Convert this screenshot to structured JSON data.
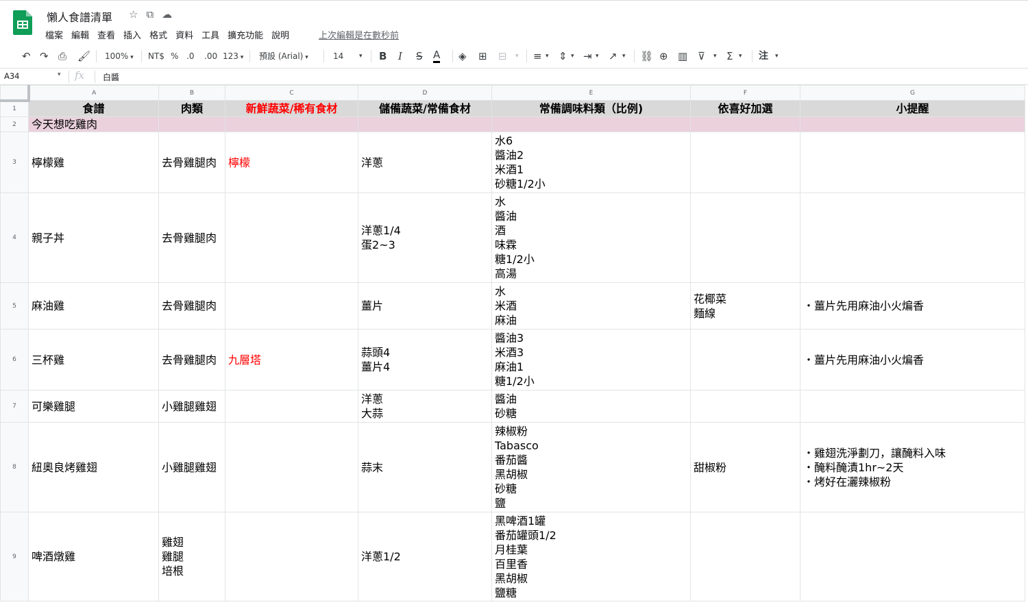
{
  "doc": {
    "title": "懶人食譜清單",
    "last_edit": "上次編輯是在數秒前",
    "menu": [
      "檔案",
      "編輯",
      "查看",
      "插入",
      "格式",
      "資料",
      "工具",
      "擴充功能",
      "說明"
    ]
  },
  "toolbar": {
    "zoom": "100%",
    "currency": "NT$",
    "percent": "%",
    "decimal_less": ".0",
    "decimal_more": ".00",
    "format_more": "123",
    "font": "預設 (Arial)",
    "font_size": "14",
    "bold": "B",
    "italic": "I",
    "strike": "S",
    "text_color": "A",
    "comment_label": "注"
  },
  "formula_bar": {
    "cell_ref": "A34",
    "fx": "fx",
    "value": "白醬"
  },
  "columns": [
    "A",
    "B",
    "C",
    "D",
    "E",
    "F",
    "G"
  ],
  "rows": [
    {
      "num": "1",
      "type": "header",
      "cells": [
        "食譜",
        "肉類",
        "新鮮蔬菜/稀有食材",
        "儲備蔬菜/常備食材",
        "常備調味料類（比例)",
        "依喜好加選",
        "小提醒"
      ]
    },
    {
      "num": "2",
      "type": "section",
      "cells": [
        "今天想吃雞肉",
        "",
        "",
        "",
        "",
        "",
        ""
      ]
    },
    {
      "num": "3",
      "type": "data",
      "cells": [
        [
          "檸檬雞"
        ],
        [
          "去骨雞腿肉"
        ],
        [
          "檸檬"
        ],
        [
          "洋蔥"
        ],
        [
          "水6",
          "醬油2",
          "米酒1",
          "砂糖1/2小"
        ],
        [],
        []
      ]
    },
    {
      "num": "4",
      "type": "data",
      "cells": [
        [
          "親子丼"
        ],
        [
          "去骨雞腿肉"
        ],
        [],
        [
          "洋蔥1/4",
          "蛋2~3"
        ],
        [
          "水",
          "醬油",
          "酒",
          "味霖",
          "糖1/2小",
          "高湯"
        ],
        [],
        []
      ]
    },
    {
      "num": "5",
      "type": "data",
      "cells": [
        [
          "麻油雞"
        ],
        [
          "去骨雞腿肉"
        ],
        [],
        [
          "薑片"
        ],
        [
          "水",
          "米酒",
          "麻油"
        ],
        [
          "花椰菜",
          "麵線"
        ],
        [
          "・薑片先用麻油小火煸香"
        ]
      ]
    },
    {
      "num": "6",
      "type": "data",
      "cells": [
        [
          "三杯雞"
        ],
        [
          "去骨雞腿肉"
        ],
        [
          "九層塔"
        ],
        [
          "蒜頭4",
          "薑片4"
        ],
        [
          "醬油3",
          "米酒3",
          "麻油1",
          "糖1/2小"
        ],
        [],
        [
          "・薑片先用麻油小火煸香"
        ]
      ]
    },
    {
      "num": "7",
      "type": "data",
      "cells": [
        [
          "可樂雞腿"
        ],
        [
          "小雞腿雞翅"
        ],
        [],
        [
          "洋蔥",
          "大蒜"
        ],
        [
          "醬油",
          "砂糖"
        ],
        [],
        []
      ]
    },
    {
      "num": "8",
      "type": "data",
      "cells": [
        [
          "紐奧良烤雞翅"
        ],
        [
          "小雞腿雞翅"
        ],
        [],
        [
          "蒜末"
        ],
        [
          "辣椒粉",
          "Tabasco",
          "番茄醬",
          "黑胡椒",
          "砂糖",
          "鹽"
        ],
        [
          "甜椒粉"
        ],
        [
          "・雞翅洗淨劃刀，讓醃料入味",
          "・醃料醃漬1hr~2天",
          "・烤好在灑辣椒粉"
        ]
      ]
    },
    {
      "num": "9",
      "type": "data",
      "cells": [
        [
          "啤酒燉雞"
        ],
        [
          "雞翅",
          "雞腿",
          "培根"
        ],
        [],
        [
          "洋蔥1/2"
        ],
        [
          "黑啤酒1罐",
          "番茄罐頭1/2",
          "月桂葉",
          "百里香",
          "黑胡椒",
          "鹽糖"
        ],
        [],
        []
      ]
    }
  ],
  "colors": {
    "header_fill": "#d9d9d9",
    "section_fill": "#ead1dc",
    "red_text": "#ff0000",
    "sheets_green": "#0f9d58"
  }
}
